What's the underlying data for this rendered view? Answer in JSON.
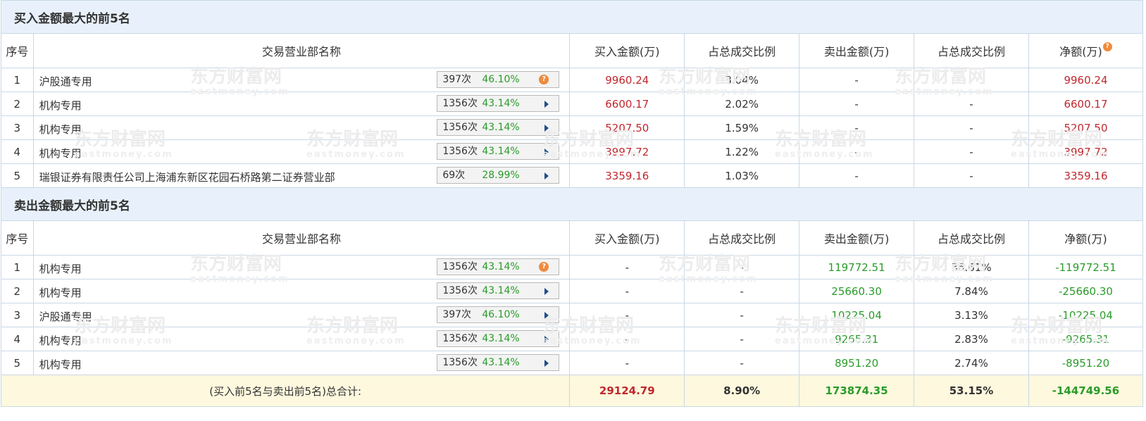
{
  "buy_section": {
    "title": "买入金额最大的前5名",
    "headers": [
      "序号",
      "交易营业部名称",
      "买入金额(万)",
      "占总成交比例",
      "卖出金额(万)",
      "占总成交比例",
      "净额(万)"
    ],
    "rows": [
      {
        "no": "1",
        "name": "沪股通专用",
        "times": "397次",
        "pct": "46.10%",
        "marker": "help-icon",
        "buy": "9960.24",
        "buy_ratio": "3.04%",
        "sell": "-",
        "sell_ratio": "-",
        "net": "9960.24"
      },
      {
        "no": "2",
        "name": "机构专用",
        "times": "1356次",
        "pct": "43.14%",
        "marker": "arrow-icon",
        "buy": "6600.17",
        "buy_ratio": "2.02%",
        "sell": "-",
        "sell_ratio": "-",
        "net": "6600.17"
      },
      {
        "no": "3",
        "name": "机构专用",
        "times": "1356次",
        "pct": "43.14%",
        "marker": "arrow-icon",
        "buy": "5207.50",
        "buy_ratio": "1.59%",
        "sell": "-",
        "sell_ratio": "-",
        "net": "5207.50"
      },
      {
        "no": "4",
        "name": "机构专用",
        "times": "1356次",
        "pct": "43.14%",
        "marker": "arrow-icon",
        "buy": "3997.72",
        "buy_ratio": "1.22%",
        "sell": "-",
        "sell_ratio": "-",
        "net": "3997.72"
      },
      {
        "no": "5",
        "name": "瑞银证券有限责任公司上海浦东新区花园石桥路第二证券营业部",
        "times": "69次",
        "pct": "28.99%",
        "marker": "arrow-icon",
        "buy": "3359.16",
        "buy_ratio": "1.03%",
        "sell": "-",
        "sell_ratio": "-",
        "net": "3359.16"
      }
    ]
  },
  "sell_section": {
    "title": "卖出金额最大的前5名",
    "headers": [
      "序号",
      "交易营业部名称",
      "买入金额(万)",
      "占总成交比例",
      "卖出金额(万)",
      "占总成交比例",
      "净额(万)"
    ],
    "rows": [
      {
        "no": "1",
        "name": "机构专用",
        "times": "1356次",
        "pct": "43.14%",
        "marker": "help-icon",
        "buy": "-",
        "buy_ratio": "-",
        "sell": "119772.51",
        "sell_ratio": "36.61%",
        "net": "-119772.51"
      },
      {
        "no": "2",
        "name": "机构专用",
        "times": "1356次",
        "pct": "43.14%",
        "marker": "arrow-icon",
        "buy": "-",
        "buy_ratio": "-",
        "sell": "25660.30",
        "sell_ratio": "7.84%",
        "net": "-25660.30"
      },
      {
        "no": "3",
        "name": "沪股通专用",
        "times": "397次",
        "pct": "46.10%",
        "marker": "arrow-icon",
        "buy": "-",
        "buy_ratio": "-",
        "sell": "10225.04",
        "sell_ratio": "3.13%",
        "net": "-10225.04"
      },
      {
        "no": "4",
        "name": "机构专用",
        "times": "1356次",
        "pct": "43.14%",
        "marker": "arrow-icon",
        "buy": "-",
        "buy_ratio": "-",
        "sell": "9265.31",
        "sell_ratio": "2.83%",
        "net": "-9265.31"
      },
      {
        "no": "5",
        "name": "机构专用",
        "times": "1356次",
        "pct": "43.14%",
        "marker": "arrow-icon",
        "buy": "-",
        "buy_ratio": "-",
        "sell": "8951.20",
        "sell_ratio": "2.74%",
        "net": "-8951.20"
      }
    ]
  },
  "total": {
    "label": "(买入前5名与卖出前5名)总合计:",
    "buy": "29124.79",
    "buy_ratio": "8.90%",
    "sell": "173874.35",
    "sell_ratio": "53.15%",
    "net": "-144749.56"
  },
  "watermark": {
    "text": "东方财富网",
    "sub": "eastmoney.com"
  },
  "colors": {
    "positive": "#c1272d",
    "negative": "#2a9b2a",
    "section_bg": "#e8f1fb",
    "total_bg": "#fdf8de",
    "border": "#c9d7e6",
    "help": "#f08a3c",
    "arrow": "#1f4f8a"
  }
}
